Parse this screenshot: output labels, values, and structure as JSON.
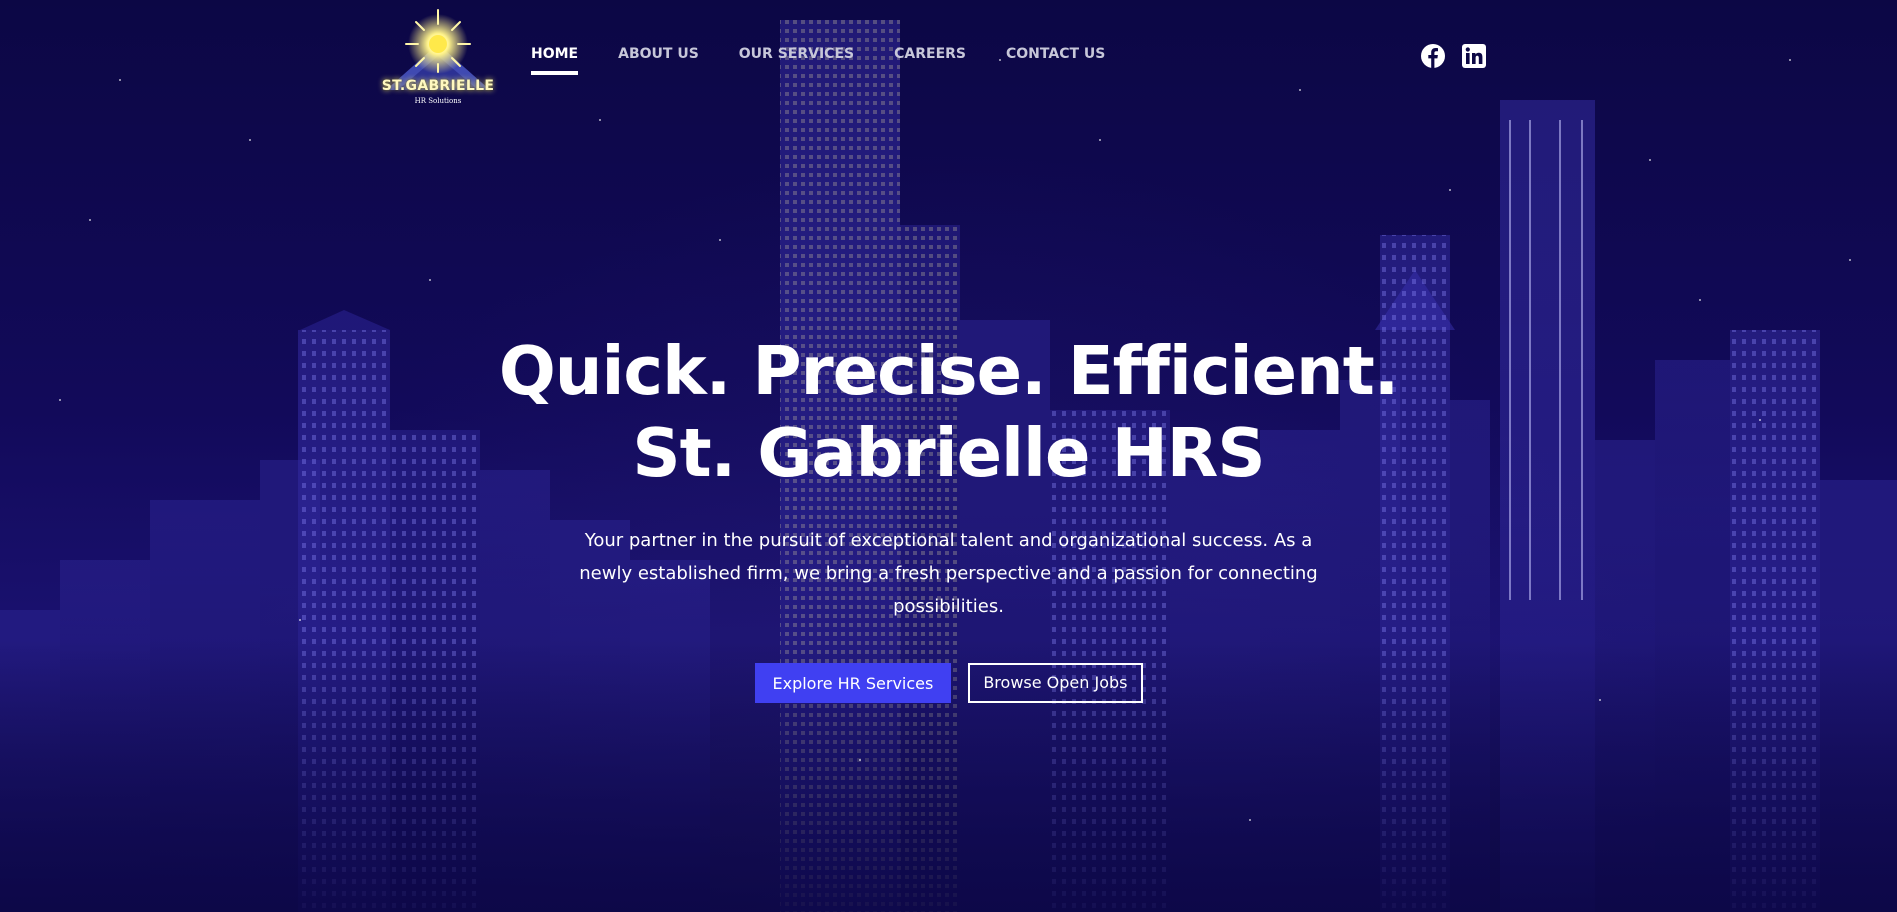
{
  "brand": {
    "name": "ST.GABRIELLE",
    "tagline": "HR Solutions",
    "logo_icon": "sunburst-mountain-icon"
  },
  "nav": {
    "items": [
      {
        "label": "HOME",
        "active": true
      },
      {
        "label": "ABOUT US",
        "active": false
      },
      {
        "label": "OUR SERVICES",
        "active": false
      },
      {
        "label": "CAREERS",
        "active": false
      },
      {
        "label": "CONTACT US",
        "active": false
      }
    ]
  },
  "social": {
    "facebook_icon": "facebook-icon",
    "linkedin_icon": "linkedin-icon"
  },
  "hero": {
    "title_line1": "Quick. Precise. Efficient.",
    "title_line2": "St. Gabrielle HRS",
    "description": "Your partner in the pursuit of exceptional talent and organizational success. As a newly established firm, we bring a fresh perspective and a passion for connecting possibilities.",
    "primary_cta": "Explore HR Services",
    "secondary_cta": "Browse Open Jobs"
  },
  "colors": {
    "background": "#0c0745",
    "accent": "#4040f2",
    "text": "#ffffff",
    "nav_inactive": "#c7c7d9",
    "logo_glow": "#fff27a"
  }
}
